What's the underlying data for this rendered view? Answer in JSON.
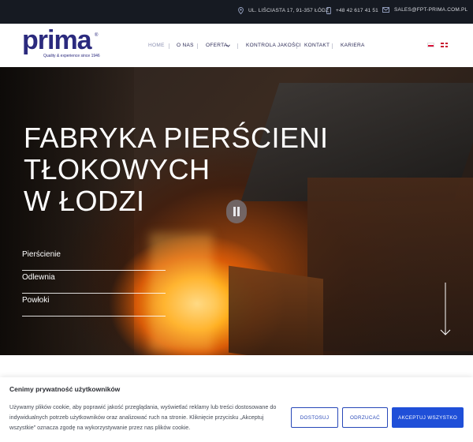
{
  "topbar": {
    "address": "UL. LIŚCIASTA 17, 91-357 ŁÓDŹ",
    "phone": "+48 42 617 41 51",
    "email": "SALES@FPT-PRIMA.COM.PL"
  },
  "logo": {
    "word": "prima",
    "registered": "®",
    "tagline": "Quality & experience since 1946"
  },
  "nav": {
    "items": [
      {
        "label": "HOME",
        "active": true
      },
      {
        "label": "O NAS"
      },
      {
        "label": "OFERTA",
        "dropdown": true
      },
      {
        "label": "KONTROLA JAKOŚCI"
      },
      {
        "label": "KONTAKT"
      },
      {
        "label": "KARIERA"
      }
    ],
    "chevron": "chevron-down-icon",
    "languages": [
      "pl-flag-icon",
      "en-flag-icon"
    ]
  },
  "hero": {
    "title_lines": [
      "FABRYKA PIERŚCIENI",
      "TŁOKOWYCH",
      "W ŁODZI"
    ],
    "links": [
      "Pierścienie",
      "Odlewnia",
      "Powłoki"
    ]
  },
  "cookie": {
    "title": "Cenimy prywatność użytkowników",
    "text": "Używamy plików cookie, aby poprawić jakość przeglądania, wyświetlać reklamy lub treści dostosowane do indywidualnych potrzeb użytkowników oraz analizować ruch na stronie. Kliknięcie przycisku „Akceptuj wszystkie” oznacza zgodę na wykorzystywanie przez nas plików cookie.",
    "btn_customize": "DOSTOSUJ",
    "btn_reject": "ODRZUCAĆ",
    "btn_accept": "AKCEPTUJ WSZYSTKO"
  },
  "colors": {
    "brand": "#2b2a7e",
    "topbar": "#161a22",
    "accent_button": "#1f4fd8"
  }
}
